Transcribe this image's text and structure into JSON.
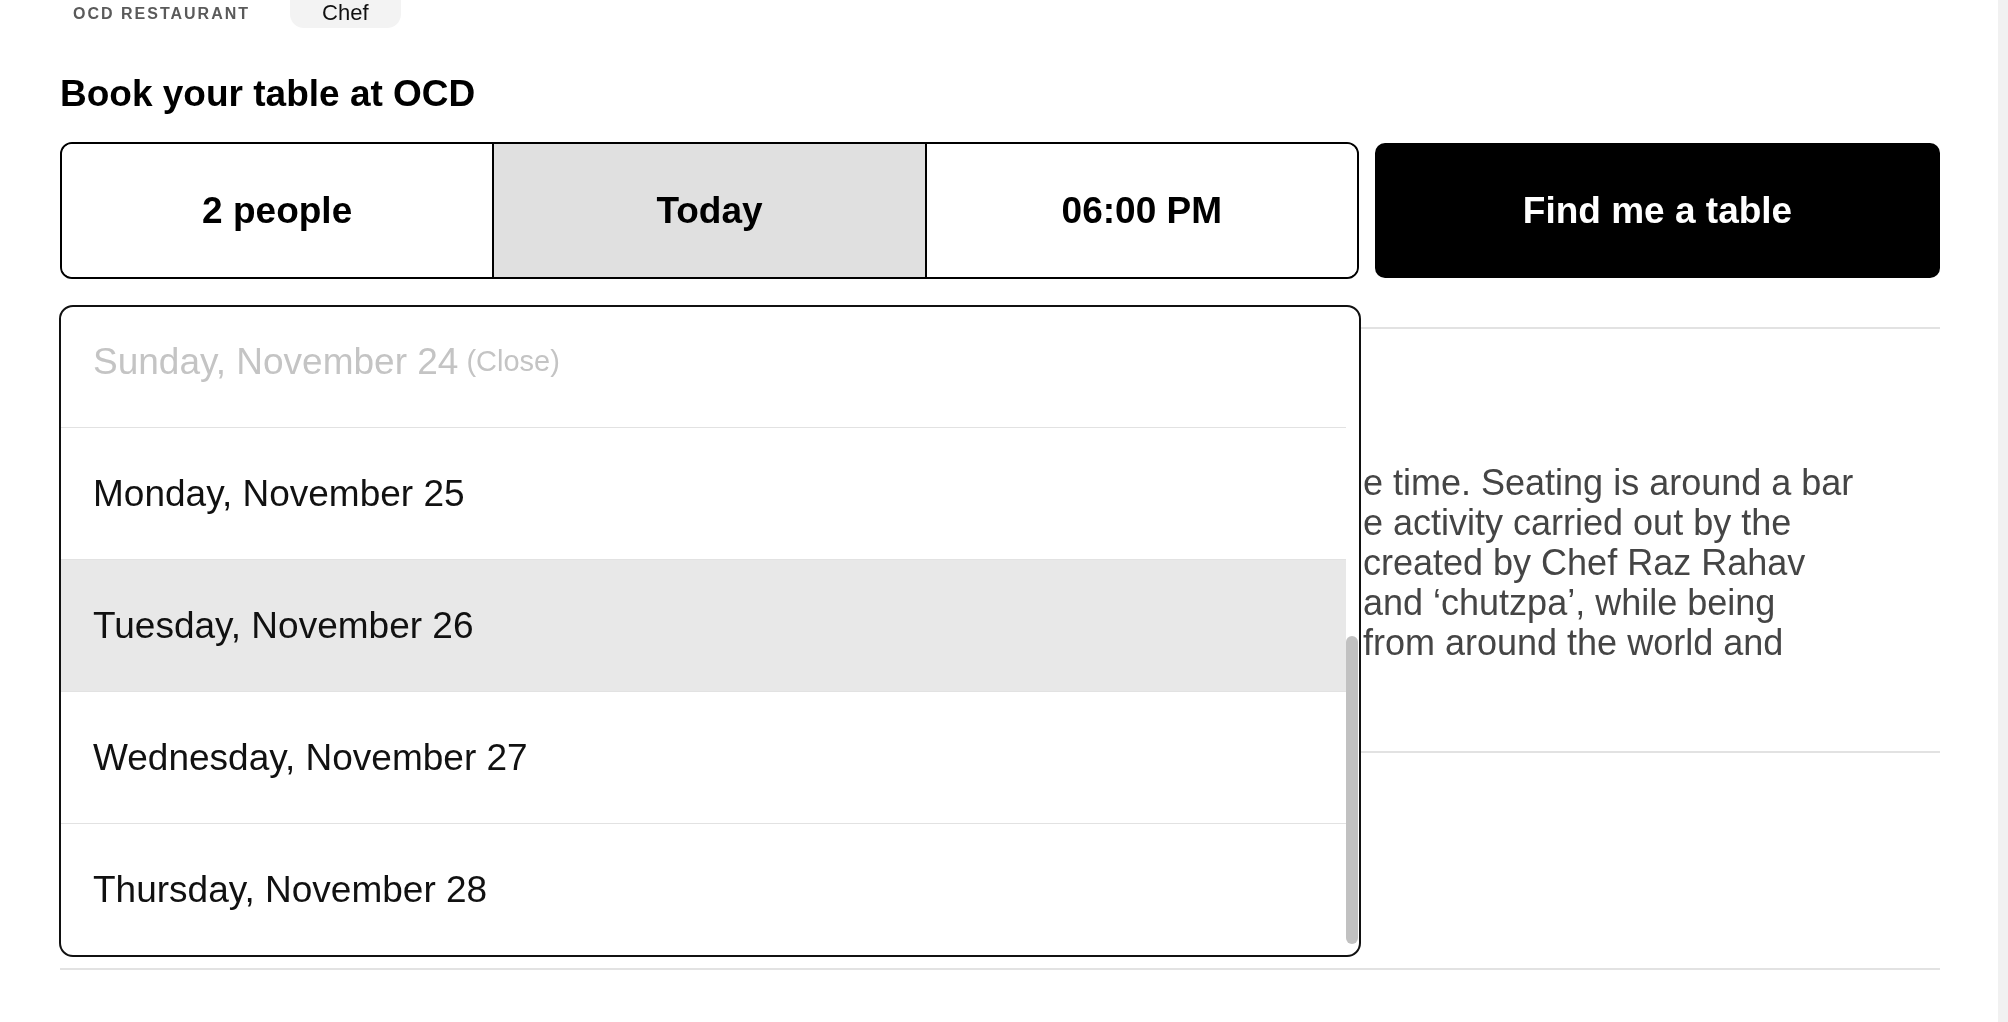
{
  "header": {
    "logo": "OCD RESTAURANT",
    "tag": "Chef"
  },
  "booking": {
    "title": "Book your table at OCD",
    "fields": [
      {
        "label": "2 people",
        "selected": false
      },
      {
        "label": "Today",
        "selected": true
      },
      {
        "label": "06:00 PM",
        "selected": false
      }
    ],
    "submit_button": "Find me a table"
  },
  "date_dropdown": {
    "options": [
      {
        "label": "Sunday, November 24",
        "note": "(Close)",
        "disabled": true,
        "selected": false
      },
      {
        "label": "Monday, November 25",
        "disabled": false,
        "selected": false
      },
      {
        "label": "Tuesday, November 26",
        "disabled": false,
        "selected": true
      },
      {
        "label": "Wednesday, November 27",
        "disabled": false,
        "selected": false
      },
      {
        "label": "Thursday, November 28",
        "disabled": false,
        "selected": false
      }
    ]
  },
  "paragraph": {
    "lines": [
      "e time. Seating is around a bar",
      "e activity carried out by the",
      "created by Chef Raz Rahav",
      "and ‘chutzpa’, while being",
      "from around the world and"
    ]
  }
}
